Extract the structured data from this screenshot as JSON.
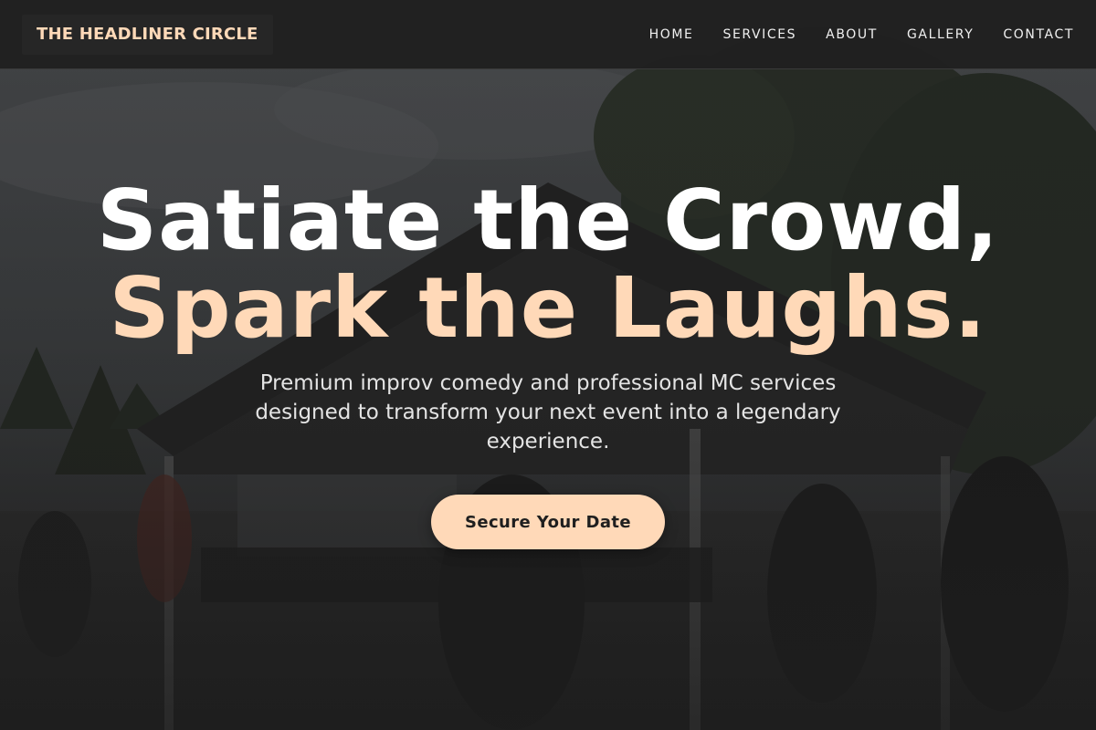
{
  "brand": {
    "name": "THE HEADLINER CIRCLE"
  },
  "nav": {
    "items": [
      {
        "label": "HOME"
      },
      {
        "label": "SERVICES"
      },
      {
        "label": "ABOUT"
      },
      {
        "label": "GALLERY"
      },
      {
        "label": "CONTACT"
      }
    ]
  },
  "hero": {
    "headline_line1": "Satiate the Crowd,",
    "headline_line2": "Spark the Laughs.",
    "subtext": "Premium improv comedy and professional MC services designed to transform your next event into a legendary experience.",
    "cta_label": "Secure Your Date",
    "background_image": "outdoor event tent with trees and crowd under overcast sky"
  },
  "colors": {
    "accent": "#ffd9b8",
    "header_bg": "#202020",
    "page_bg": "#1e1e1e",
    "text_light": "#ffffff"
  }
}
